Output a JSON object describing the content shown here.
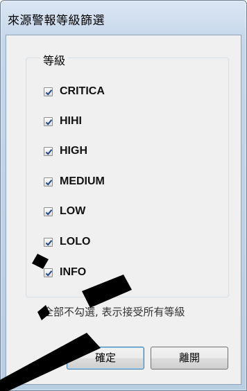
{
  "window": {
    "title": "來源警報等級篩選"
  },
  "group": {
    "legend": "等級",
    "options": [
      {
        "label": "CRITICA",
        "checked": true
      },
      {
        "label": "HIHI",
        "checked": true
      },
      {
        "label": "HIGH",
        "checked": true
      },
      {
        "label": "MEDIUM",
        "checked": true
      },
      {
        "label": "LOW",
        "checked": true
      },
      {
        "label": "LOLO",
        "checked": true
      },
      {
        "label": "INFO",
        "checked": true
      }
    ]
  },
  "hint": "全部不勾選, 表示接受所有等級",
  "buttons": {
    "ok_label": "確定",
    "close_label": "離開"
  },
  "colors": {
    "check": "#22498a",
    "accent_border": "#3c7fb1"
  }
}
